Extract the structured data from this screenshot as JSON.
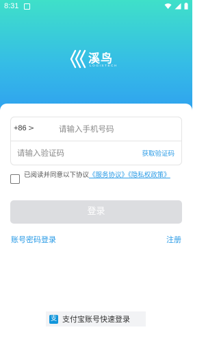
{
  "status_bar": {
    "time": "8:31"
  },
  "brand": {
    "name": "溪鸟",
    "sub": "LOGISTECH"
  },
  "login": {
    "country_code": "+86",
    "country_arrow": ">",
    "phone_placeholder": "请输入手机号码",
    "code_placeholder": "请输入验证码",
    "get_code": "获取验证码",
    "agreement_prefix": "已阅读并同意以下协议",
    "service_agreement": "《服务协议》",
    "privacy_policy": "《隐私权政策》",
    "login_button": "登录",
    "password_login": "账号密码登录",
    "register": "注册",
    "alipay_login": "支付宝账号快速登录"
  },
  "colors": {
    "accent": "#2a9be6",
    "gradient_top": "#3fe0c9",
    "gradient_bottom": "#2f9ff0",
    "button_disabled": "#dcdde0"
  }
}
